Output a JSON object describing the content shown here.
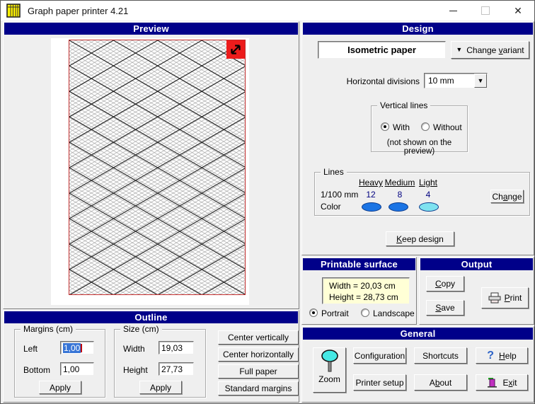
{
  "window": {
    "title": "Graph paper printer 4.21"
  },
  "preview": {
    "header": "Preview"
  },
  "design": {
    "header": "Design",
    "paper_type": "Isometric paper",
    "change_variant": "Change <u>v</u>ariant",
    "horizontal_divisions_label": "Horizontal divisions",
    "horizontal_divisions_value": "10 mm",
    "vertical_lines": {
      "legend": "Vertical lines",
      "with_label": "With",
      "without_label": "Without",
      "note": "(not shown on the preview)"
    },
    "lines": {
      "legend": "Lines",
      "columns": [
        "Heavy",
        "Medium",
        "Light"
      ],
      "thickness_label": "1/100 mm",
      "thickness_values": [
        "12",
        "8",
        "4"
      ],
      "color_label": "Color",
      "colors": [
        "#1B74E4",
        "#1B74E4",
        "#7EE2F0"
      ],
      "change": "Ch<u>a</u>nge"
    },
    "keep_design": "<u>K</u>eep design"
  },
  "printable": {
    "header": "Printable surface",
    "width_text": "Width = 20,03 cm",
    "height_text": "Height = 28,73 cm",
    "portrait_label": "Portrait",
    "landscape_label": "Landscape"
  },
  "output": {
    "header": "Output",
    "copy": "<u>C</u>opy",
    "save": "<u>S</u>ave",
    "print": "<u>P</u>rint"
  },
  "outline": {
    "header": "Outline",
    "margins": {
      "legend": "Margins (cm)",
      "left_label": "Left",
      "left_value": "1,00",
      "bottom_label": "Bottom",
      "bottom_value": "1,00",
      "apply": "Apply"
    },
    "size": {
      "legend": "Size (cm)",
      "width_label": "Width",
      "width_value": "19,03",
      "height_label": "Height",
      "height_value": "27,73",
      "apply": "Apply"
    },
    "actions": [
      "Center vertically",
      "Center horizontally",
      "Full paper",
      "Standard margins"
    ]
  },
  "general": {
    "header": "General",
    "zoom": "Zoom",
    "configuration": "Configuration",
    "shortcuts": "Shortcuts",
    "help": "<u>H</u>elp",
    "printer_setup": "Printer setup",
    "about": "A<u>b</u>out",
    "exit": "E<u>x</u>it"
  }
}
